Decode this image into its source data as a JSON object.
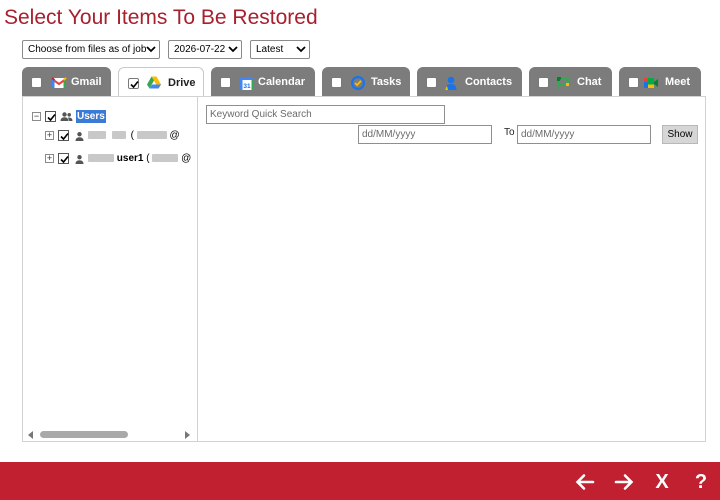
{
  "page": {
    "title": "Select Your Items To Be Restored"
  },
  "filters": {
    "source": "Choose from files as of job",
    "date": "2026-07-22",
    "version": "Latest"
  },
  "tabs": [
    {
      "label": "Gmail",
      "icon": "gmail-icon",
      "checked": false,
      "active": false
    },
    {
      "label": "Drive",
      "icon": "google-drive-icon",
      "checked": true,
      "active": true
    },
    {
      "label": "Calendar",
      "icon": "google-calendar-icon",
      "checked": false,
      "active": false
    },
    {
      "label": "Tasks",
      "icon": "google-tasks-icon",
      "checked": false,
      "active": false
    },
    {
      "label": "Contacts",
      "icon": "google-contacts-icon",
      "checked": false,
      "active": false
    },
    {
      "label": "Chat",
      "icon": "google-chat-icon",
      "checked": false,
      "active": false
    },
    {
      "label": "Meet",
      "icon": "google-meet-icon",
      "checked": false,
      "active": false
    }
  ],
  "tree": {
    "root": {
      "label": "Users",
      "checked": true,
      "expanded": true
    },
    "users": [
      {
        "label_visible": "( @",
        "checked": true,
        "expanded": false
      },
      {
        "label_visible": "user1 ( @",
        "checked": true,
        "expanded": false
      }
    ],
    "user1_name": "user1"
  },
  "search": {
    "keyword_placeholder": "Keyword Quick Search",
    "from_placeholder": "dd/MM/yyyy",
    "to_label": "To",
    "to_placeholder": "dd/MM/yyyy",
    "show_label": "Show"
  },
  "footer": {
    "back_label": "🡐",
    "next_label": "🡒",
    "close_label": "X",
    "help_label": "?"
  },
  "colors": {
    "brand": "#c0202f",
    "title": "#a81f2e",
    "tab_inactive": "#7c7c7c",
    "selection": "#3a7bd5"
  }
}
